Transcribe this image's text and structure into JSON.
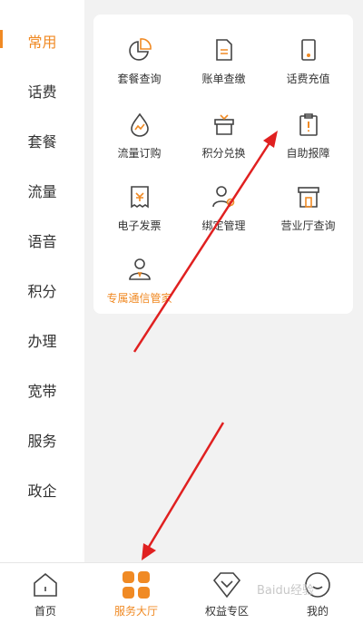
{
  "sidebar": {
    "items": [
      {
        "label": "常用",
        "active": true
      },
      {
        "label": "话费",
        "active": false
      },
      {
        "label": "套餐",
        "active": false
      },
      {
        "label": "流量",
        "active": false
      },
      {
        "label": "语音",
        "active": false
      },
      {
        "label": "积分",
        "active": false
      },
      {
        "label": "办理",
        "active": false
      },
      {
        "label": "宽带",
        "active": false
      },
      {
        "label": "服务",
        "active": false
      },
      {
        "label": "政企",
        "active": false
      }
    ]
  },
  "services": [
    {
      "label": "套餐查询",
      "icon": "pie-chart-icon"
    },
    {
      "label": "账单查缴",
      "icon": "bill-icon"
    },
    {
      "label": "话费充值",
      "icon": "phone-icon"
    },
    {
      "label": "流量订购",
      "icon": "data-drop-icon"
    },
    {
      "label": "积分兑换",
      "icon": "gift-icon"
    },
    {
      "label": "自助报障",
      "icon": "report-fault-icon"
    },
    {
      "label": "电子发票",
      "icon": "invoice-icon"
    },
    {
      "label": "绑定管理",
      "icon": "user-settings-icon"
    },
    {
      "label": "营业厅查询",
      "icon": "store-icon"
    },
    {
      "label": "专属通信管家",
      "icon": "manager-icon"
    }
  ],
  "tabbar": {
    "tabs": [
      {
        "label": "首页",
        "icon": "home-icon"
      },
      {
        "label": "服务大厅",
        "icon": "service-hall-icon"
      },
      {
        "label": "权益专区",
        "icon": "rights-icon"
      },
      {
        "label": "我的",
        "icon": "profile-icon"
      }
    ]
  },
  "watermark": "Baidu经验",
  "colors": {
    "accent": "#f08a24",
    "arrow": "#e02020",
    "icon_stroke": "#444444"
  }
}
